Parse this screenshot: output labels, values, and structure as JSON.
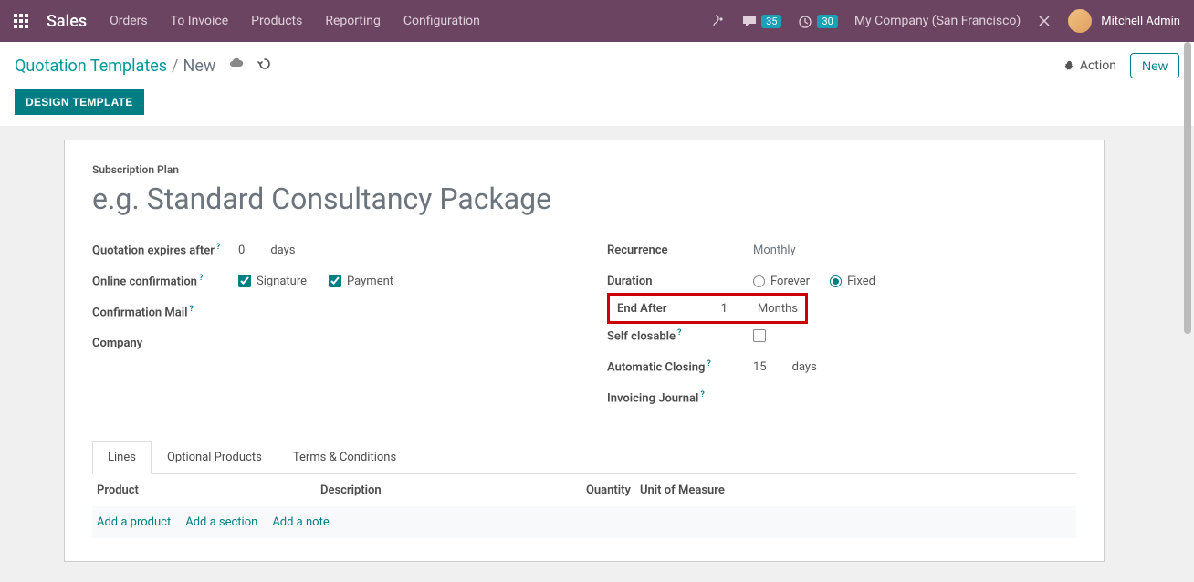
{
  "topnav": {
    "brand": "Sales",
    "links": [
      "Orders",
      "To Invoice",
      "Products",
      "Reporting",
      "Configuration"
    ],
    "chat_count": "35",
    "timer_count": "30",
    "company": "My Company (San Francisco)",
    "user": "Mitchell Admin"
  },
  "breadcrumb": {
    "parent": "Quotation Templates",
    "current": "New",
    "action": "Action",
    "new_btn": "New"
  },
  "buttons": {
    "design_template": "DESIGN TEMPLATE"
  },
  "form": {
    "section_label": "Subscription Plan",
    "title_placeholder": "e.g. Standard Consultancy Package",
    "left": {
      "expires_label": "Quotation expires after",
      "expires_value": "0",
      "expires_unit": "days",
      "online_conf_label": "Online confirmation",
      "signature_label": "Signature",
      "payment_label": "Payment",
      "conf_mail_label": "Confirmation Mail",
      "company_label": "Company"
    },
    "right": {
      "recurrence_label": "Recurrence",
      "recurrence_value": "Monthly",
      "duration_label": "Duration",
      "duration_forever": "Forever",
      "duration_fixed": "Fixed",
      "end_after_label": "End After",
      "end_after_value": "1",
      "end_after_unit": "Months",
      "self_closable_label": "Self closable",
      "auto_closing_label": "Automatic Closing",
      "auto_closing_value": "15",
      "auto_closing_unit": "days",
      "inv_journal_label": "Invoicing Journal"
    }
  },
  "tabs": {
    "lines": "Lines",
    "optional": "Optional Products",
    "terms": "Terms & Conditions"
  },
  "table": {
    "product": "Product",
    "description": "Description",
    "quantity": "Quantity",
    "uom": "Unit of Measure",
    "add_product": "Add a product",
    "add_section": "Add a section",
    "add_note": "Add a note"
  }
}
